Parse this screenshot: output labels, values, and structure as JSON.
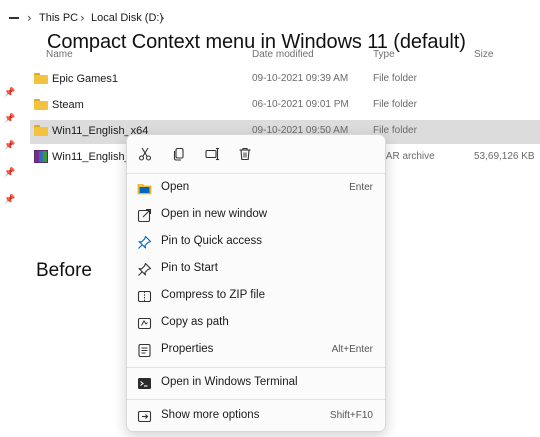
{
  "address": {
    "crumbs": [
      "This PC",
      "Local Disk (D:)"
    ],
    "separator": "›"
  },
  "annotations": {
    "title": "Compact Context menu in Windows 11 (default)",
    "before": "Before"
  },
  "columns": {
    "name": "Name",
    "date": "Date modified",
    "type": "Type",
    "size": "Size"
  },
  "files": [
    {
      "name": "Epic Games1",
      "date": "09-10-2021 09:39 AM",
      "type": "File folder",
      "size": "",
      "icon": "folder-icon"
    },
    {
      "name": "Steam",
      "date": "06-10-2021 09:01 PM",
      "type": "File folder",
      "size": "",
      "icon": "folder-icon"
    },
    {
      "name": "Win11_English_x64",
      "date": "09-10-2021 09:50 AM",
      "type": "File folder",
      "size": "",
      "icon": "folder-icon",
      "selected": true
    },
    {
      "name": "Win11_English_x",
      "date": "",
      "type": "nRAR archive",
      "size": "53,69,126 KB",
      "icon": "winrar-archive-icon"
    }
  ],
  "context_menu": {
    "quick_actions": [
      {
        "name": "cut",
        "icon": "scissors-icon"
      },
      {
        "name": "copy",
        "icon": "copy-icon"
      },
      {
        "name": "rename",
        "icon": "rename-icon"
      },
      {
        "name": "delete",
        "icon": "trash-icon"
      }
    ],
    "items": [
      {
        "label": "Open",
        "shortcut": "Enter",
        "icon": "open-folder-icon"
      },
      {
        "label": "Open in new window",
        "shortcut": "",
        "icon": "new-window-icon"
      },
      {
        "label": "Pin to Quick access",
        "shortcut": "",
        "icon": "pin-icon"
      },
      {
        "label": "Pin to Start",
        "shortcut": "",
        "icon": "pin-start-icon"
      },
      {
        "label": "Compress to ZIP file",
        "shortcut": "",
        "icon": "zip-icon"
      },
      {
        "label": "Copy as path",
        "shortcut": "",
        "icon": "copy-path-icon"
      },
      {
        "label": "Properties",
        "shortcut": "Alt+Enter",
        "icon": "properties-icon"
      },
      {
        "label": "Open in Windows Terminal",
        "shortcut": "",
        "icon": "terminal-icon"
      },
      {
        "label": "Show more options",
        "shortcut": "Shift+F10",
        "icon": "more-options-icon"
      }
    ]
  },
  "colors": {
    "accent": "#0067c0",
    "folder": "#f3c23e",
    "selection": "#dcdcdc"
  }
}
